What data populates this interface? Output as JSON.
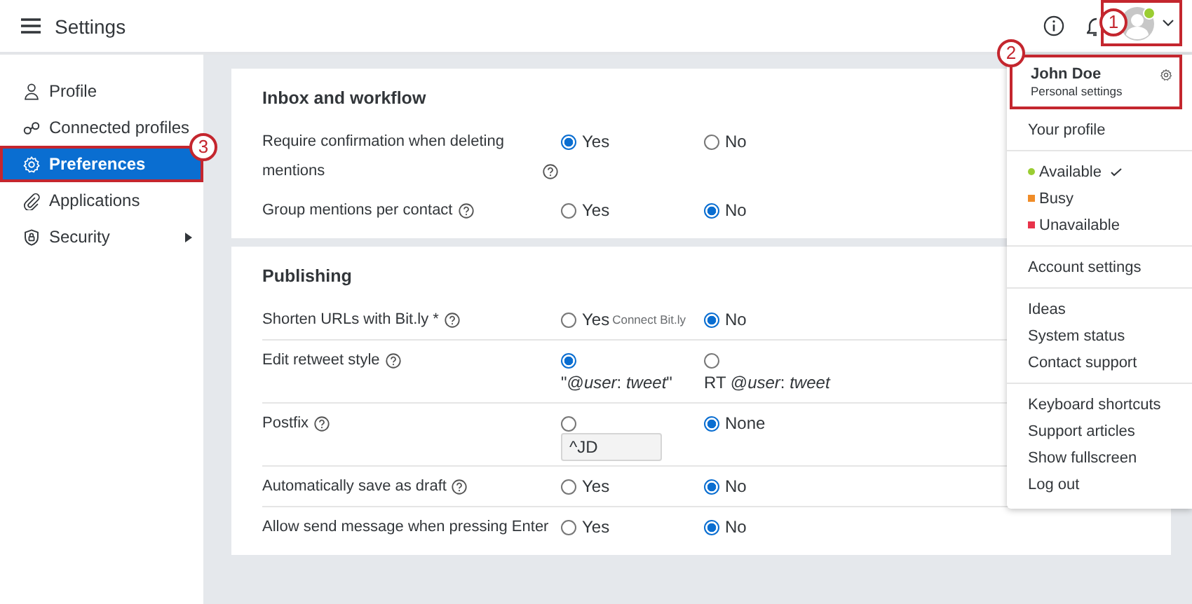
{
  "top_bar": {
    "title": "Settings",
    "account": {
      "online": true,
      "callout": "1"
    }
  },
  "sidebar": {
    "items": [
      {
        "label": "Profile",
        "selected": false,
        "submenu": false
      },
      {
        "label": "Connected profiles",
        "selected": false,
        "submenu": false
      },
      {
        "label": "Preferences",
        "selected": true,
        "submenu": false,
        "callout": "3"
      },
      {
        "label": "Applications",
        "selected": false,
        "submenu": false
      },
      {
        "label": "Security",
        "selected": false,
        "submenu": true
      }
    ]
  },
  "sections": [
    {
      "title": "Inbox and workflow",
      "divided": false,
      "rows": [
        {
          "label": "Require confirmation when deleting mentions",
          "help": true,
          "options": [
            {
              "label": "Yes",
              "selected": true
            },
            {
              "label": "No",
              "selected": false
            }
          ]
        },
        {
          "label": "Group mentions per contact",
          "help": true,
          "options": [
            {
              "label": "Yes",
              "selected": false
            },
            {
              "label": "No",
              "selected": true
            }
          ]
        }
      ]
    },
    {
      "title": "Publishing",
      "divided": true,
      "rows": [
        {
          "label": "Shorten URLs with Bit.ly *",
          "help": true,
          "options": [
            {
              "label": "Yes",
              "selected": false,
              "note": "Connect Bit.ly"
            },
            {
              "label": "No",
              "selected": true
            }
          ]
        },
        {
          "label": "Edit retweet style",
          "help": true,
          "options": [
            {
              "label": "\"@*user*: *tweet*\"",
              "selected": true
            },
            {
              "label": "RT @*user*: *tweet*",
              "selected": false
            }
          ]
        },
        {
          "label": "Postfix",
          "help": true,
          "options": [
            {
              "selected": false,
              "field_value": "^JD"
            },
            {
              "label": "None",
              "selected": true
            }
          ]
        },
        {
          "label": "Automatically save as draft",
          "help": true,
          "options": [
            {
              "label": "Yes",
              "selected": false
            },
            {
              "label": "No",
              "selected": true
            }
          ]
        },
        {
          "label": "Allow send message when pressing Enter",
          "help": false,
          "options": [
            {
              "label": "Yes",
              "selected": false
            },
            {
              "label": "No",
              "selected": true
            }
          ]
        }
      ]
    }
  ],
  "account_menu": {
    "name": "John Doe",
    "subtitle": "Personal settings",
    "callout": "2",
    "groups": [
      {
        "items": [
          {
            "label": "Your profile"
          }
        ]
      },
      {
        "items": [
          {
            "label": "Available",
            "color": "#9acd32",
            "selected": true
          },
          {
            "label": "Busy",
            "color": "#f08c28",
            "selected": false
          },
          {
            "label": "Unavailable",
            "color": "#e8334a",
            "selected": false
          }
        ]
      },
      {
        "items": [
          {
            "label": "Account settings"
          }
        ]
      },
      {
        "items": [
          {
            "label": "Ideas"
          },
          {
            "label": "System status"
          },
          {
            "label": "Contact support"
          }
        ]
      },
      {
        "items": [
          {
            "label": "Keyboard shortcuts"
          },
          {
            "label": "Support articles"
          },
          {
            "label": "Show fullscreen"
          },
          {
            "label": "Log out"
          }
        ]
      }
    ]
  }
}
